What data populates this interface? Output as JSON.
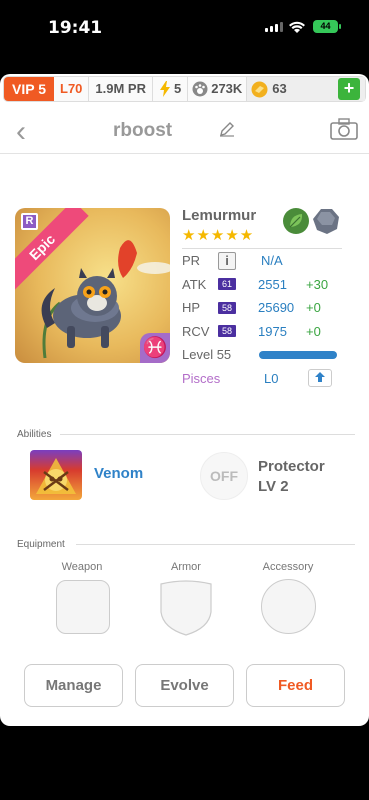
{
  "status": {
    "time": "19:41",
    "battery": "44"
  },
  "resources": {
    "vip": "VIP 5",
    "level": "L70",
    "power_rating": "1.9M PR",
    "energy": "5",
    "food": "273K",
    "coins": "63",
    "add_label": "+"
  },
  "header": {
    "back": "‹",
    "title": "rboost"
  },
  "creature": {
    "name": "Lemurmur",
    "rarity": "Epic",
    "rarity_badge": "R",
    "zodiac_symbol": "♓",
    "stars": "★★★★★",
    "star_count": 5,
    "elements": [
      "leaf",
      "stone"
    ]
  },
  "stats": {
    "pr_label": "PR",
    "pr_info": "i",
    "pr_value": "N/A",
    "rows": [
      {
        "label": "ATK",
        "level": "61",
        "value": "2551",
        "bonus": "+30"
      },
      {
        "label": "HP",
        "level": "58",
        "value": "25690",
        "bonus": "+0"
      },
      {
        "label": "RCV",
        "level": "58",
        "value": "1975",
        "bonus": "+0"
      }
    ],
    "level_label": "Level 55",
    "level_progress": 1.0,
    "zodiac_label": "Pisces",
    "zodiac_level": "L0"
  },
  "abilities": {
    "section_label": "Abilities",
    "items": [
      {
        "name": "Venom",
        "state": ""
      },
      {
        "name": "Protector",
        "level": "LV 2",
        "state": "OFF"
      }
    ]
  },
  "equipment": {
    "section_label": "Equipment",
    "slots": [
      "Weapon",
      "Armor",
      "Accessory"
    ]
  },
  "actions": {
    "manage": "Manage",
    "evolve": "Evolve",
    "feed": "Feed"
  },
  "colors": {
    "accent": "#f05a23",
    "link": "#2a7fc0",
    "bonus": "#3aa541",
    "star": "#f5b800",
    "zodiac": "#a56cc8"
  }
}
